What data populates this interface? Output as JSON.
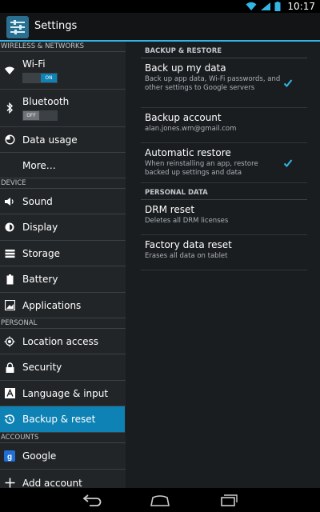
{
  "status_bar": {
    "time": "10:17",
    "icons": [
      "wifi-icon",
      "signal-icon",
      "battery-icon"
    ]
  },
  "action_bar": {
    "title": "Settings",
    "icon": "settings-icon"
  },
  "sidebar": {
    "wireless_header": "WIRELESS & NETWORKS",
    "wifi": {
      "label": "Wi-Fi",
      "toggle": "ON"
    },
    "bluetooth": {
      "label": "Bluetooth",
      "toggle": "OFF"
    },
    "data_usage": "Data usage",
    "more": "More…",
    "device_header": "DEVICE",
    "sound": "Sound",
    "display": "Display",
    "storage": "Storage",
    "battery": "Battery",
    "applications": "Applications",
    "personal_header": "PERSONAL",
    "location": "Location access",
    "security": "Security",
    "language": "Language & input",
    "backup": "Backup & reset",
    "accounts_header": "ACCOUNTS",
    "google": "Google",
    "add_account": "Add account"
  },
  "detail": {
    "backup_header": "BACKUP & RESTORE",
    "backup_data": {
      "title": "Back up my data",
      "summary": "Back up app data, Wi-Fi passwords, and other settings to Google servers",
      "checked": true
    },
    "backup_account": {
      "title": "Backup account",
      "summary": "alan.jones.wm@gmail.com"
    },
    "auto_restore": {
      "title": "Automatic restore",
      "summary": "When reinstalling an app, restore backed up settings and data",
      "checked": true
    },
    "personal_header": "PERSONAL DATA",
    "drm_reset": {
      "title": "DRM reset",
      "summary": "Deletes all DRM licenses"
    },
    "factory_reset": {
      "title": "Factory data reset",
      "summary": "Erases all data on tablet"
    }
  },
  "colors": {
    "accent": "#33b5e5",
    "selected": "#0e82b4",
    "checkmark": "#33b5e5"
  }
}
